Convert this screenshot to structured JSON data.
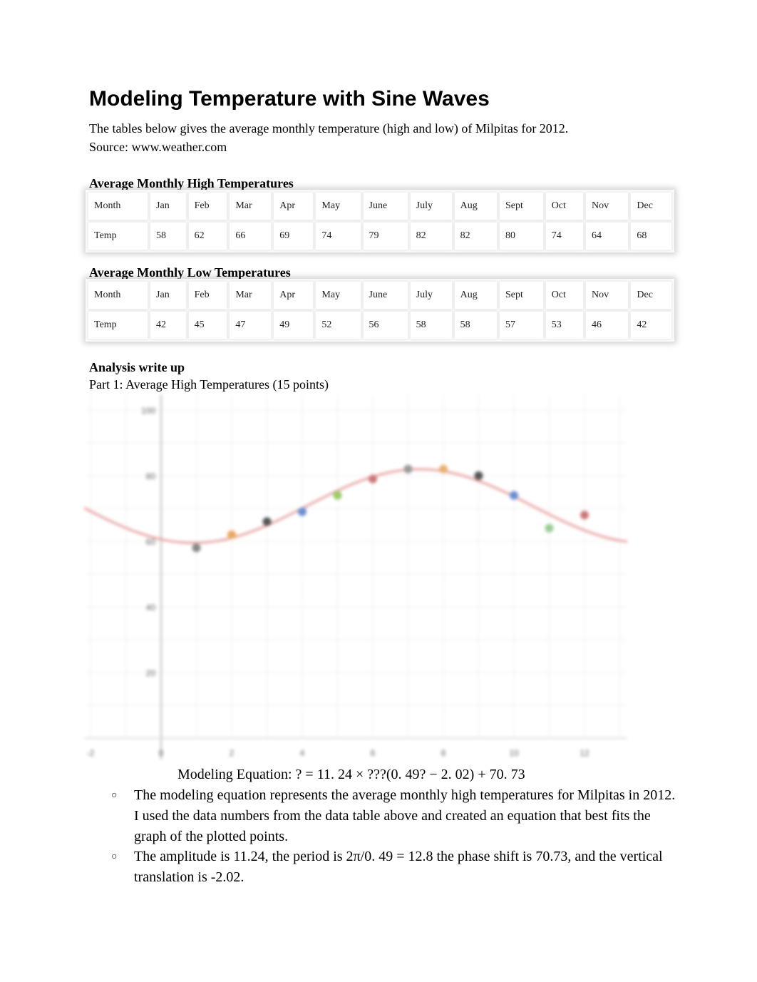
{
  "title": "Modeling Temperature with Sine Waves",
  "intro": "The tables below gives the average monthly temperature (high and low) of Milpitas for 2012.",
  "source": "Source: www.weather.com",
  "high_table": {
    "heading": "Average Monthly High Temperatures",
    "row1": [
      "Month",
      "Jan",
      "Feb",
      "Mar",
      "Apr",
      "May",
      "June",
      "July",
      "Aug",
      "Sept",
      "Oct",
      "Nov",
      "Dec"
    ],
    "row2": [
      "Temp",
      "58",
      "62",
      "66",
      "69",
      "74",
      "79",
      "82",
      "82",
      "80",
      "74",
      "64",
      "68"
    ]
  },
  "low_table": {
    "heading": "Average Monthly Low Temperatures",
    "row1": [
      "Month",
      "Jan",
      "Feb",
      "Mar",
      "Apr",
      "May",
      "June",
      "July",
      "Aug",
      "Sept",
      "Oct",
      "Nov",
      "Dec"
    ],
    "row2": [
      "Temp",
      "42",
      "45",
      "47",
      "49",
      "52",
      "56",
      "58",
      "58",
      "57",
      "53",
      "46",
      "42"
    ]
  },
  "analysis_heading": "Analysis write up",
  "part1": "Part 1: Average High Temperatures (15 points)",
  "chart_data": {
    "type": "scatter",
    "x": [
      1,
      2,
      3,
      4,
      5,
      6,
      7,
      8,
      9,
      10,
      11,
      12
    ],
    "y": [
      58,
      62,
      66,
      69,
      74,
      79,
      82,
      82,
      80,
      74,
      64,
      68
    ],
    "curve": {
      "amplitude": 11.24,
      "b": 0.49,
      "c": 2.02,
      "d": 70.73
    },
    "xlim": [
      -2,
      13
    ],
    "ylim": [
      0,
      100
    ],
    "xticks": [
      -2,
      0,
      2,
      4,
      6,
      8,
      10,
      12
    ],
    "yticks": [
      20,
      40,
      60,
      80,
      100
    ],
    "grid": true,
    "point_colors": [
      "#888",
      "#e8a860",
      "#555",
      "#6a8fd0",
      "#9c6",
      "#c77",
      "#999",
      "#e8b070",
      "#555",
      "#6a8fd0",
      "#9c9",
      "#c77"
    ],
    "curve_color": "#e8a0a0"
  },
  "equation": "Modeling Equation: ? = 11. 24 × ???(0. 49? − 2. 02) + 70. 73",
  "bullets": [
    "The modeling equation represents the average monthly high temperatures for Milpitas in 2012. I used the data numbers from the data table above and created an equation that best fits the graph of the plotted points.",
    "The amplitude is 11.24, the period is 2π/0. 49 =  12.8 the phase shift is 70.73, and the vertical translation is -2.02."
  ],
  "bullet_glyph": "○"
}
